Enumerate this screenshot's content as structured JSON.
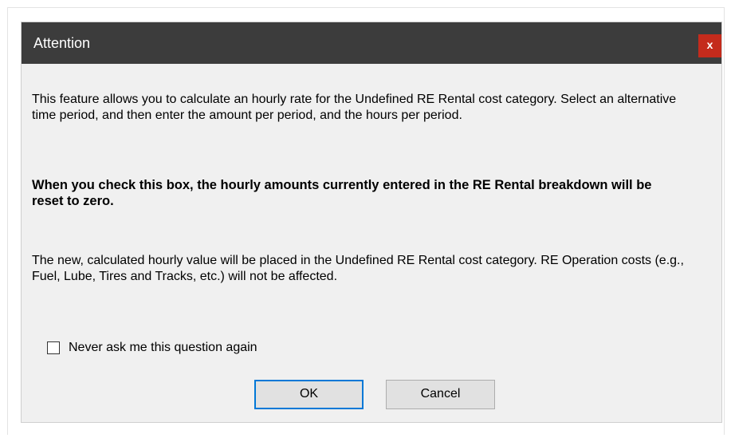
{
  "dialog": {
    "title": "Attention",
    "close_label": "x",
    "paragraph1": "This feature allows you to calculate an hourly rate for the Undefined RE Rental cost category. Select an alternative time period, and then enter the amount per period, and the hours per period.",
    "paragraph2": "When you check this box, the hourly amounts currently entered in the RE Rental breakdown will be reset to zero.",
    "paragraph3": "The new, calculated hourly value will be placed in the Undefined RE Rental cost category. RE Operation costs (e.g., Fuel, Lube, Tires and Tracks, etc.) will not be affected.",
    "checkbox_label": "Never ask me this question again",
    "checkbox_checked": false,
    "ok_label": "OK",
    "cancel_label": "Cancel"
  },
  "colors": {
    "titlebar": "#3c3c3c",
    "close_button": "#c42b1c",
    "dialog_background": "#f0f0f0",
    "default_button_border": "#0078d7"
  }
}
